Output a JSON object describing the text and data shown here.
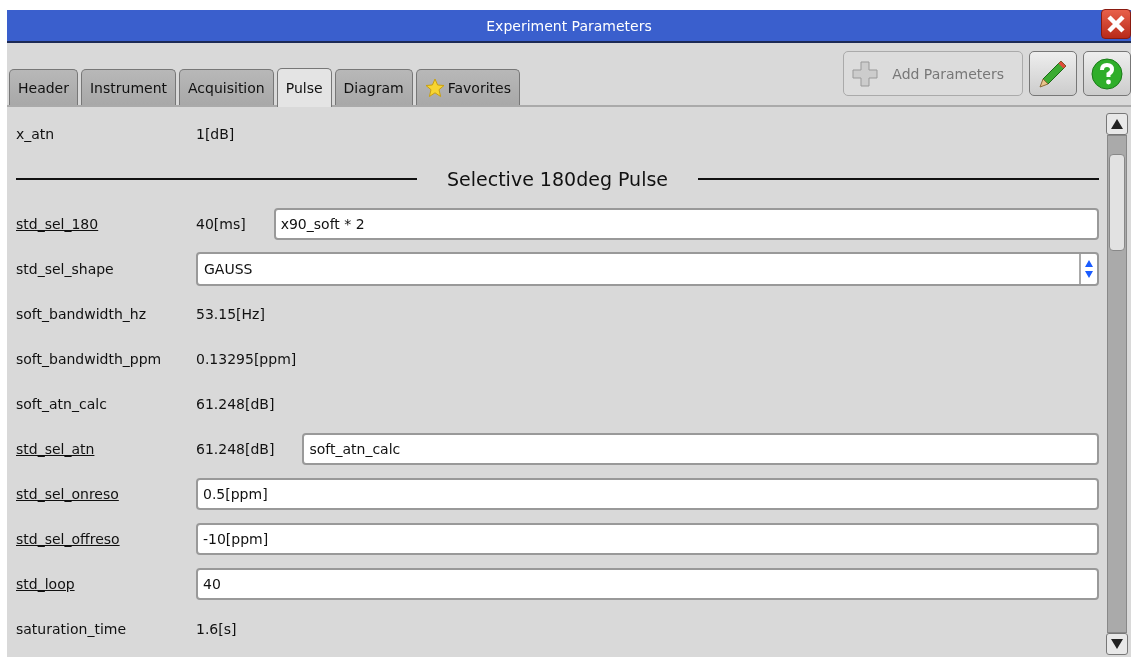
{
  "window": {
    "title": "Experiment Parameters"
  },
  "tabs": [
    {
      "label": "Header",
      "selected": false
    },
    {
      "label": "Instrument",
      "selected": false
    },
    {
      "label": "Acquisition",
      "selected": false
    },
    {
      "label": "Pulse",
      "selected": true
    },
    {
      "label": "Diagram",
      "selected": false
    },
    {
      "label": "Favorites",
      "selected": false,
      "kind": "favorites"
    }
  ],
  "toolbar": {
    "add_button": {
      "label": "Add Parameters",
      "disabled": true
    }
  },
  "rows": [
    {
      "kind": "value",
      "label": "x_atn",
      "linked": false,
      "reading": "1[dB]"
    },
    {
      "kind": "section",
      "label": "Selective 180deg Pulse"
    },
    {
      "kind": "input",
      "label": "std_sel_180",
      "linked": true,
      "reading": "40[ms]",
      "value": "x90_soft * 2"
    },
    {
      "kind": "select",
      "label": "std_sel_shape",
      "linked": false,
      "value": "GAUSS"
    },
    {
      "kind": "value",
      "label": "soft_bandwidth_hz",
      "linked": false,
      "reading": "53.15[Hz]"
    },
    {
      "kind": "value",
      "label": "soft_bandwidth_ppm",
      "linked": false,
      "reading": "0.13295[ppm]"
    },
    {
      "kind": "value",
      "label": "soft_atn_calc",
      "linked": false,
      "reading": "61.248[dB]"
    },
    {
      "kind": "input",
      "label": "std_sel_atn",
      "linked": true,
      "reading": "61.248[dB]",
      "value": "soft_atn_calc"
    },
    {
      "kind": "input",
      "label": "std_sel_onreso",
      "linked": true,
      "value": "0.5[ppm]"
    },
    {
      "kind": "input",
      "label": "std_sel_offreso",
      "linked": true,
      "value": "-10[ppm]"
    },
    {
      "kind": "input",
      "label": "std_loop",
      "linked": true,
      "value": "40"
    },
    {
      "kind": "value",
      "label": "saturation_time",
      "linked": false,
      "reading": "1.6[s]"
    }
  ]
}
